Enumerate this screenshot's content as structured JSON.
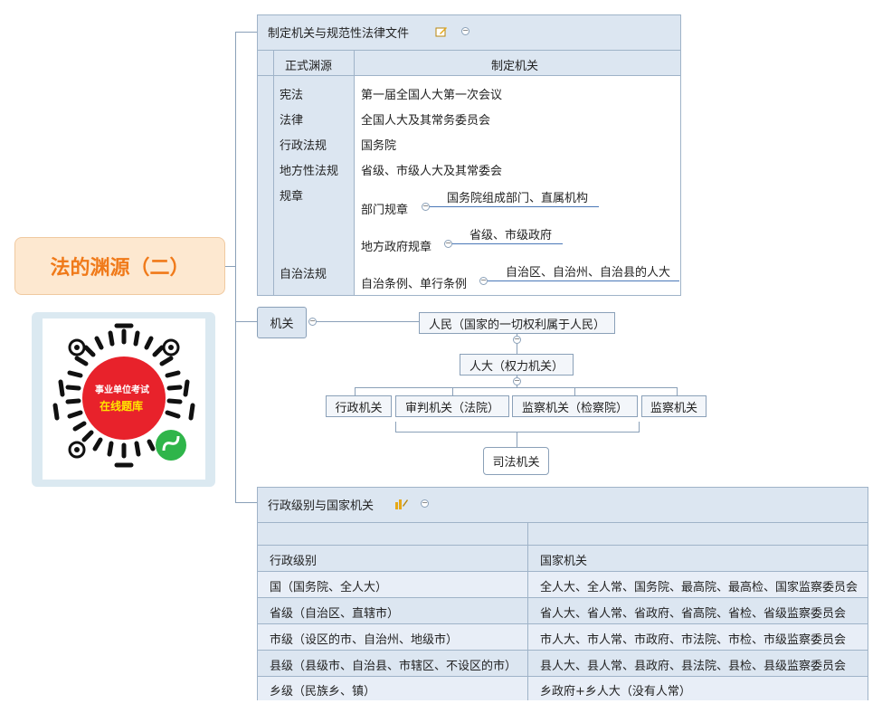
{
  "root": {
    "title": "法的渊源（二）"
  },
  "qr": {
    "line1": "事业单位考试",
    "line2": "在线题库"
  },
  "branch1": {
    "title": "制定机关与规范性法律文件",
    "icon": "edit-note-icon",
    "headers": {
      "col1": "正式渊源",
      "col2": "制定机关"
    },
    "rows": [
      {
        "source": "宪法",
        "organ": "第一届全国人大第一次会议"
      },
      {
        "source": "法律",
        "organ": "全国人大及其常务委员会"
      },
      {
        "source": "行政法规",
        "organ": "国务院"
      },
      {
        "source": "地方性法规",
        "organ": "省级、市级人大及其常委会"
      },
      {
        "source": "规章",
        "organ": ""
      },
      {
        "source": "自治法规",
        "organ": ""
      }
    ],
    "dept_rule": {
      "label": "部门规章",
      "child": "国务院组成部门、直属机构"
    },
    "local_rule": {
      "label": "地方政府规章",
      "child": "省级、市级政府"
    },
    "autonomy": {
      "label": "自治条例、单行条例",
      "child": "自治区、自治州、自治县的人大"
    }
  },
  "branch2": {
    "title": "机关",
    "people": "人民（国家的一切权利属于人民）",
    "npc": "人大（权力机关）",
    "organs": [
      "行政机关",
      "审判机关（法院）",
      "监察机关（检察院）",
      "监察机关"
    ],
    "judicial": "司法机关"
  },
  "branch3": {
    "title": "行政级别与国家机关",
    "icon": "chart-edit-icon",
    "headers": {
      "col1": "行政级别",
      "col2": "国家机关"
    },
    "rows": [
      {
        "level": "国（国务院、全人大）",
        "organs": "全人大、全人常、国务院、最高院、最高检、国家监察委员会"
      },
      {
        "level": "省级（自治区、直辖市）",
        "organs": "省人大、省人常、省政府、省高院、省检、省级监察委员会"
      },
      {
        "level": "市级（设区的市、自治州、地级市）",
        "organs": "市人大、市人常、市政府、市法院、市检、市级监察委员会"
      },
      {
        "level": "县级（县级市、自治县、市辖区、不设区的市）",
        "organs": "县人大、县人常、县政府、县法院、县检、县级监察委员会"
      },
      {
        "level": "乡级（民族乡、镇）",
        "organs": "乡政府+乡人大（没有人常）"
      }
    ]
  },
  "colors": {
    "accent": "#f07a1a",
    "panel": "#dce6f1",
    "line": "#8aa0b8",
    "qr_badge": "#e8222b"
  }
}
